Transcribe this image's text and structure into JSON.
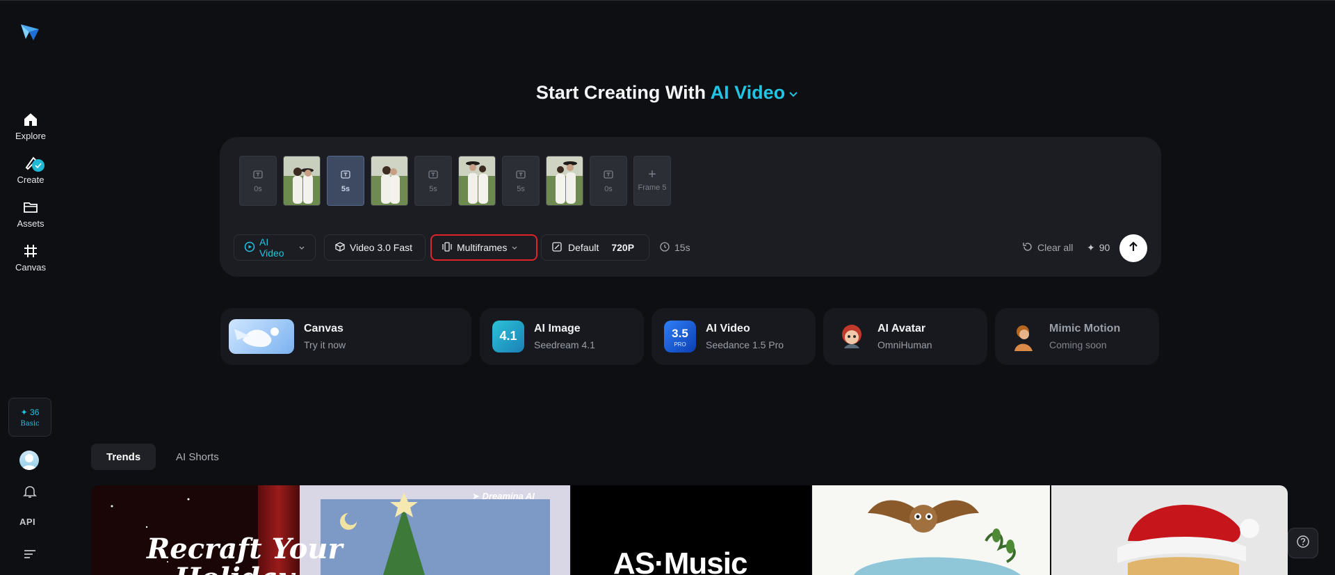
{
  "sidebar": {
    "items": [
      {
        "label": "Explore",
        "icon": "home-icon"
      },
      {
        "label": "Create",
        "icon": "create-icon"
      },
      {
        "label": "Assets",
        "icon": "folder-icon"
      },
      {
        "label": "Canvas",
        "icon": "canvas-icon"
      }
    ],
    "credits": "36",
    "plan": "Basic",
    "api_label": "API"
  },
  "hero": {
    "prefix": "Start Creating With",
    "mode": "AI Video"
  },
  "composer": {
    "frames": [
      {
        "kind": "duration",
        "label": "0s"
      },
      {
        "kind": "image"
      },
      {
        "kind": "duration",
        "label": "5s",
        "selected": true
      },
      {
        "kind": "image"
      },
      {
        "kind": "duration",
        "label": "5s"
      },
      {
        "kind": "image"
      },
      {
        "kind": "duration",
        "label": "5s"
      },
      {
        "kind": "image"
      },
      {
        "kind": "duration",
        "label": "0s"
      }
    ],
    "add_frame_label": "Frame 5",
    "toolbar": {
      "mode": "AI Video",
      "model": "Video 3.0 Fast",
      "frames_mode": "Multiframes",
      "ratio": "Default",
      "resolution": "720P",
      "duration": "15s",
      "clear": "Clear all",
      "cost": "90"
    }
  },
  "cards": [
    {
      "title": "Canvas",
      "subtitle": "Try it now"
    },
    {
      "title": "AI Image",
      "subtitle": "Seedream 4.1",
      "badge": "4.1"
    },
    {
      "title": "AI Video",
      "subtitle": "Seedance 1.5 Pro",
      "badge": "3.5",
      "badge_sub": "PRO"
    },
    {
      "title": "AI Avatar",
      "subtitle": "OmniHuman"
    },
    {
      "title": "Mimic Motion",
      "subtitle": "Coming soon"
    }
  ],
  "tabs": [
    "Trends",
    "AI Shorts"
  ],
  "gallery": {
    "tile1_text": "Recraft Your",
    "tile1_text2": "Holiday",
    "tile1_watermark": "Dreamina AI",
    "tile2_text": "AS·Music"
  },
  "colors": {
    "accent": "#22c4e4",
    "highlight": "#e0242c",
    "background": "#0e0f13",
    "panel": "#1b1d23"
  }
}
